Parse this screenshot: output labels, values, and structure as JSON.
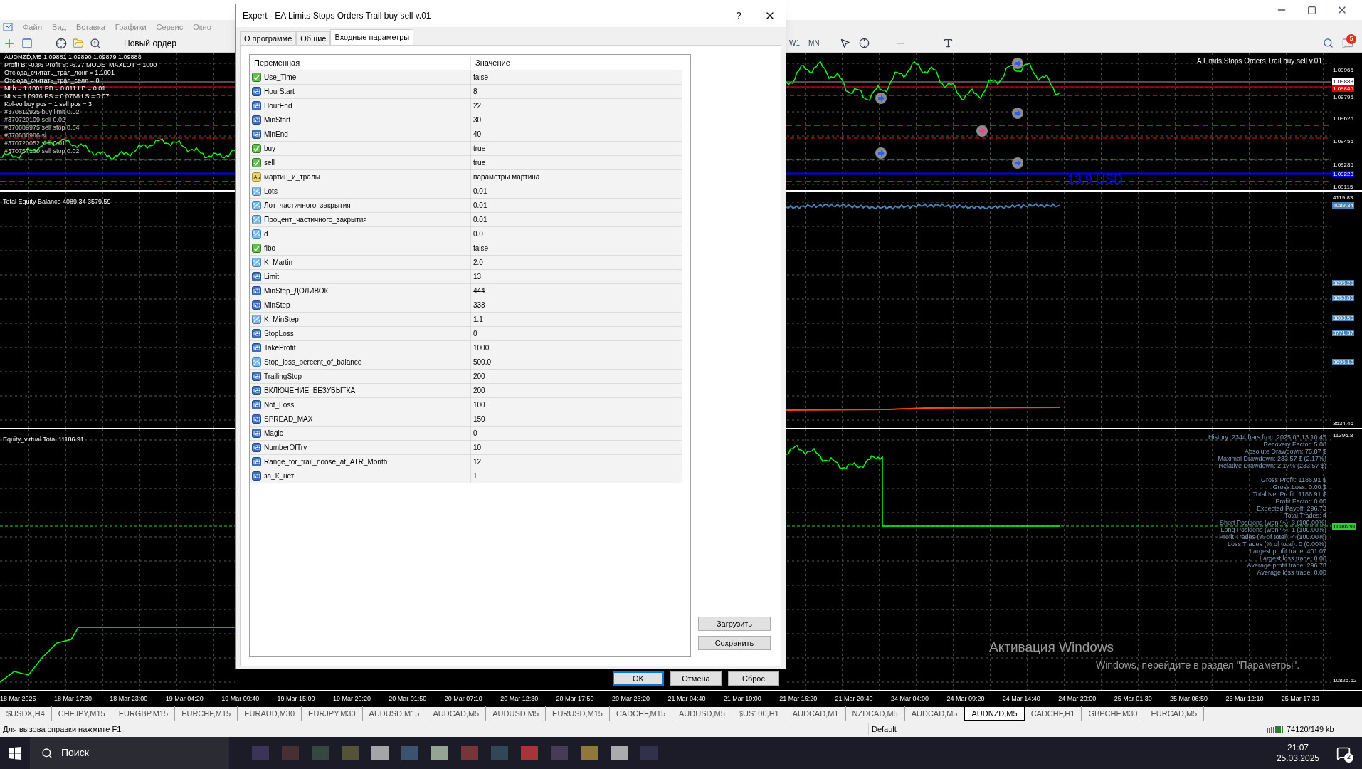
{
  "menu": [
    {
      "label": "Файл"
    },
    {
      "label": "Вид"
    },
    {
      "label": "Вставка"
    },
    {
      "label": "Графики"
    },
    {
      "label": "Сервис"
    },
    {
      "label": "Окно"
    }
  ],
  "toolbar": {
    "new_order": "Новый ордер",
    "periods": [
      "W1",
      "MN"
    ],
    "notifications": "5"
  },
  "chart": {
    "title": "EA Limits Stops Orders Trail buy sell v.01",
    "info_lines": [
      "AUDNZD,M5 1.09881 1.09890 1.09879 1.09888",
      "Profit B: -0.86 Profit S: -6.27 MODE_MAXLOT = 1000",
      "Отсюда_считать_трал_лонг = 1.1001",
      "Отсюда_считать_трал_селл = 0",
      "NLb = 1.1001 PB = 0.011 LB = 0.01",
      "NLs = 1.0976 PS = 0.0768 LS = 0.07",
      "Kol-vo buy pos = 1 sell pos = 3"
    ],
    "order_labels": [
      "#370812925 buy limit 0.02",
      "#370720109 sell 0.02",
      "#370689975 sell stop 0.04",
      "#370686986 sl",
      "#370720052 sell 0.01",
      "#370757100 sell stop 0.02"
    ],
    "profit_label": "13.9 USD",
    "price_axis": [
      {
        "text": "1.09965",
        "kind": "plain"
      },
      {
        "text": "1.09888",
        "kind": "bid"
      },
      {
        "text": "1.09845",
        "kind": "level"
      },
      {
        "text": "1.09795",
        "kind": "plain"
      },
      {
        "text": "1.09625",
        "kind": "plain"
      },
      {
        "text": "1.09455",
        "kind": "plain"
      },
      {
        "text": "1.09285",
        "kind": "plain"
      },
      {
        "text": "1.09223",
        "kind": "line"
      },
      {
        "text": "1.09115",
        "kind": "plain"
      }
    ]
  },
  "equity_pane": {
    "label": "Total Equity Balance 4089.34 3579.59",
    "price_axis": [
      {
        "text": "4119.83",
        "kind": "plain"
      },
      {
        "text": "4089.34",
        "kind": "equity"
      },
      {
        "text": "3895.28",
        "kind": "equity"
      },
      {
        "text": "3858.89",
        "kind": "equity"
      },
      {
        "text": "3808.50",
        "kind": "equity"
      },
      {
        "text": "3771.37",
        "kind": "equity"
      },
      {
        "text": "3696.18",
        "kind": "equity"
      },
      {
        "text": "3534.46",
        "kind": "plain"
      }
    ]
  },
  "virtual_pane": {
    "label": "Equity_virtual Total 11186.91",
    "stat_groups": [
      [
        "History: 2344 bars from 2025.03.13 10:45",
        "Recovery Factor: 5.08",
        "Absolute Drawdown: 75.07 $",
        "Maximal Drawdown: 233.57 $ (2.17%)",
        "Relative Drawdown: 2.17% (233.57 $)"
      ],
      [
        "Gross Profit: 1186.91 $",
        "Gross Loss: 0.00 $",
        "Total Net Profit: 1186.91 $",
        "Profit Factor: 0.00",
        "Expected Payoff: 296.73",
        "Total Trades: 4",
        "Short Positions (won %): 3 (100.00%)",
        "Long Positions (won %): 1 (100.00%)",
        "Profit Trades (% of total): 4 (100.00%)",
        "Loss Trades (% of total): 0 (0.00%)",
        "Largest profit trade: 401.07",
        "Largest loss trade: 0.00",
        "Average profit trade: 296.73",
        "Average loss trade: 0.00"
      ]
    ],
    "price_axis": [
      {
        "text": "11396.8",
        "kind": "plain"
      },
      {
        "text": "11186.91",
        "kind": "current"
      },
      {
        "text": "10825.62",
        "kind": "plain"
      }
    ]
  },
  "time_axis": [
    "18 Mar 2025",
    "18 Mar 17:30",
    "18 Mar 23:00",
    "19 Mar 04:20",
    "19 Mar 09:40",
    "19 Mar 15:00",
    "19 Mar 20:20",
    "20 Mar 01:50",
    "20 Mar 07:10",
    "20 Mar 12:30",
    "20 Mar 17:50",
    "20 Mar 23:20",
    "21 Mar 04:40",
    "21 Mar 10:00",
    "21 Mar 15:20",
    "21 Mar 20:40",
    "24 Mar 04:00",
    "24 Mar 09:20",
    "24 Mar 14:40",
    "24 Mar 20:00",
    "25 Mar 01:30",
    "25 Mar 06:50",
    "25 Mar 12:10",
    "25 Mar 17:30"
  ],
  "os_notice": {
    "title": "Активация Windows",
    "text": "Windows, перейдите в раздел \"Параметры\"."
  },
  "dialog": {
    "title": "Expert - EA Limits Stops Orders Trail buy sell v.01",
    "help": "?",
    "tabs": [
      {
        "label": "О программе",
        "selected": false
      },
      {
        "label": "Общие",
        "selected": false
      },
      {
        "label": "Входные параметры",
        "selected": true
      }
    ],
    "columns": [
      "Переменная",
      "Значение"
    ],
    "params": [
      {
        "name": "Use_Time",
        "value": "false",
        "kind": "bool"
      },
      {
        "name": "HourStart",
        "value": "8",
        "kind": "int"
      },
      {
        "name": "HourEnd",
        "value": "22",
        "kind": "int"
      },
      {
        "name": "MinStart",
        "value": "30",
        "kind": "int"
      },
      {
        "name": "MinEnd",
        "value": "40",
        "kind": "int"
      },
      {
        "name": "buy",
        "value": "true",
        "kind": "bool"
      },
      {
        "name": "sell",
        "value": "true",
        "kind": "bool"
      },
      {
        "name": "мартин_и_тралы",
        "value": "параметры мартина",
        "kind": "string"
      },
      {
        "name": "Lots",
        "value": "0.01",
        "kind": "double"
      },
      {
        "name": "Лот_частичного_закрытия",
        "value": "0.01",
        "kind": "double"
      },
      {
        "name": "Процент_частичного_закрытия",
        "value": "0.01",
        "kind": "double"
      },
      {
        "name": "d",
        "value": "0.0",
        "kind": "double"
      },
      {
        "name": "fibo",
        "value": "false",
        "kind": "bool"
      },
      {
        "name": "K_Martin",
        "value": "2.0",
        "kind": "double"
      },
      {
        "name": "Limit",
        "value": "13",
        "kind": "int"
      },
      {
        "name": "MinStep_ДОЛИВОК",
        "value": "444",
        "kind": "int"
      },
      {
        "name": "MinStep",
        "value": "333",
        "kind": "int"
      },
      {
        "name": "K_MinStep",
        "value": "1.1",
        "kind": "double"
      },
      {
        "name": "StopLoss",
        "value": "0",
        "kind": "int"
      },
      {
        "name": "TakeProfit",
        "value": "1000",
        "kind": "int"
      },
      {
        "name": "Stop_loss_percent_of_balance",
        "value": "500.0",
        "kind": "double"
      },
      {
        "name": "TrailingStop",
        "value": "200",
        "kind": "int"
      },
      {
        "name": "ВКЛЮЧЕНИЕ_БЕЗУБЫТКА",
        "value": "200",
        "kind": "int"
      },
      {
        "name": "Not_Loss",
        "value": "100",
        "kind": "int"
      },
      {
        "name": "SPREAD_MAX",
        "value": "150",
        "kind": "int"
      },
      {
        "name": "Magic",
        "value": "0",
        "kind": "int"
      },
      {
        "name": "NumberOfTry",
        "value": "10",
        "kind": "int"
      },
      {
        "name": "Range_for_trail_noose_at_ATR_Month",
        "value": "12",
        "kind": "int"
      },
      {
        "name": "за_К_нет",
        "value": "1",
        "kind": "int"
      }
    ],
    "side_buttons": [
      "Загрузить",
      "Сохранить"
    ],
    "buttons": [
      {
        "label": "OK",
        "kind": "default"
      },
      {
        "label": "Отмена",
        "kind": "normal"
      },
      {
        "label": "Сброс",
        "kind": "normal"
      }
    ]
  },
  "symbol_tabs": [
    {
      "label": "$USDX,H4",
      "selected": false
    },
    {
      "label": "CHFJPY,M15",
      "selected": false
    },
    {
      "label": "EURGBP,M15",
      "selected": false
    },
    {
      "label": "EURCHF,M15",
      "selected": false
    },
    {
      "label": "EURAUD,M30",
      "selected": false
    },
    {
      "label": "EURJPY,M30",
      "selected": false
    },
    {
      "label": "AUDUSD,M15",
      "selected": false
    },
    {
      "label": "AUDCAD,M5",
      "selected": false
    },
    {
      "label": "AUDUSD,M5",
      "selected": false
    },
    {
      "label": "EURUSD,M15",
      "selected": false
    },
    {
      "label": "CADCHF,M15",
      "selected": false
    },
    {
      "label": "AUDUSD,M5",
      "selected": false
    },
    {
      "label": "$US100,H1",
      "selected": false
    },
    {
      "label": "AUDCAD,M1",
      "selected": false
    },
    {
      "label": "NZDCAD,M5",
      "selected": false
    },
    {
      "label": "AUDCAD,M5",
      "selected": false
    },
    {
      "label": "AUDNZD,M5",
      "selected": true
    },
    {
      "label": "CADCHF,H1",
      "selected": false
    },
    {
      "label": "GBPCHF,M30",
      "selected": false
    },
    {
      "label": "EURCAD,M5",
      "selected": false
    }
  ],
  "status_bar": {
    "help": "Для вызова справки нажмите F1",
    "profile": "Default",
    "traffic": "74120/149 kb"
  },
  "taskbar": {
    "search": "Поиск",
    "time": "21:07",
    "date": "25.03.2025",
    "notifications": "2"
  }
}
